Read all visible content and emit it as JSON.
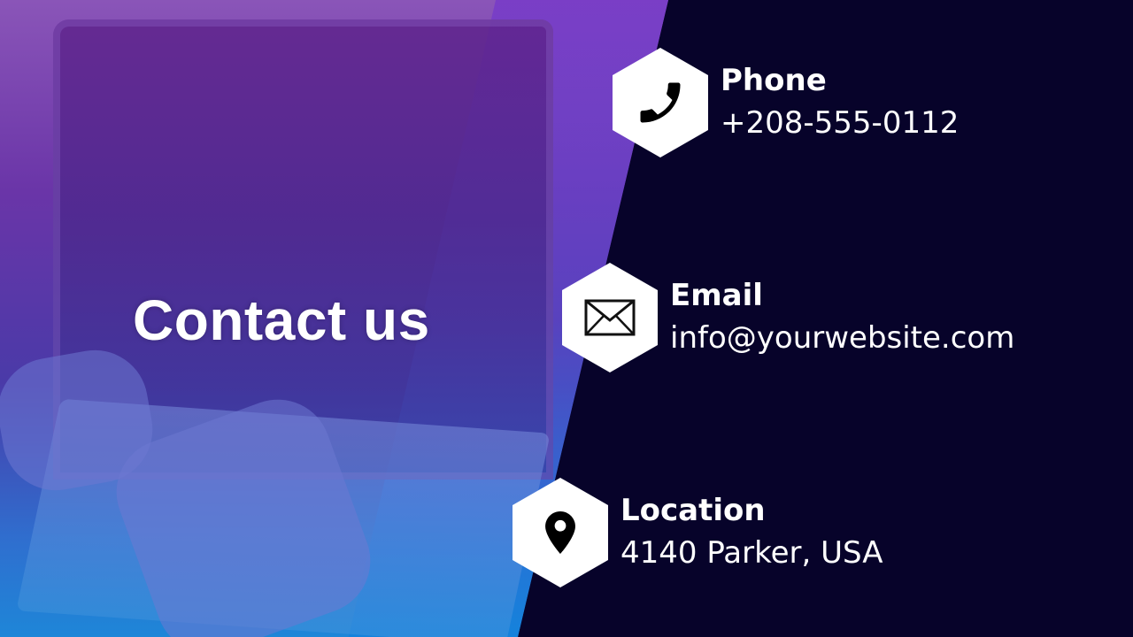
{
  "hero": {
    "title": "Contact us"
  },
  "contacts": [
    {
      "label": "Phone",
      "value": "+208-555-0112",
      "icon": "phone-icon"
    },
    {
      "label": "Email",
      "value": "info@yourwebsite.com",
      "icon": "mail-icon"
    },
    {
      "label": "Location",
      "value": "4140 Parker, USA",
      "icon": "location-pin-icon"
    }
  ],
  "colors": {
    "background": "#07032a",
    "accent_purple": "#6a35a8",
    "accent_blue": "#1e86d8",
    "text": "#ffffff"
  }
}
